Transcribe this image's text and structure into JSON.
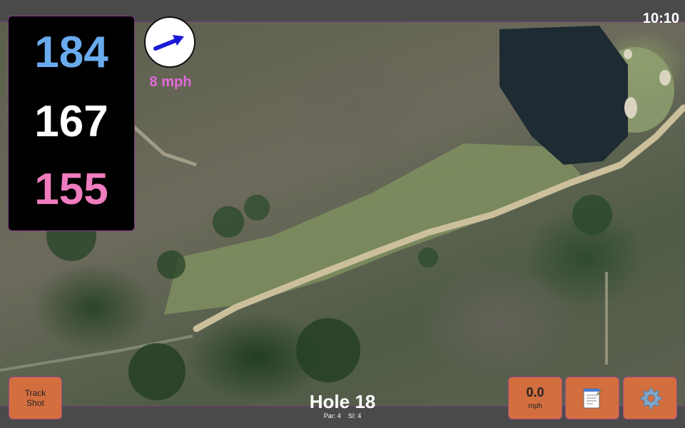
{
  "status_bar": {
    "time": "10:10"
  },
  "distances": {
    "back": "184",
    "middle": "167",
    "front": "155"
  },
  "wind": {
    "speed_label": "8 mph",
    "direction_icon": "wind-arrow-icon"
  },
  "buttons": {
    "track_shot_line1": "Track",
    "track_shot_line2": "Shot",
    "speed_value": "0.0",
    "speed_unit": "mph",
    "notes_icon": "notepad-icon",
    "settings_icon": "gear-icon"
  },
  "hole": {
    "title": "Hole 18",
    "par_label": "Par: 4",
    "si_label": "SI: 4"
  },
  "colors": {
    "back_distance": "#6aabee",
    "middle_distance": "#ffffff",
    "front_distance": "#ef7cbe",
    "wind_text": "#e36ad7",
    "button_fill": "#d36e3f"
  }
}
